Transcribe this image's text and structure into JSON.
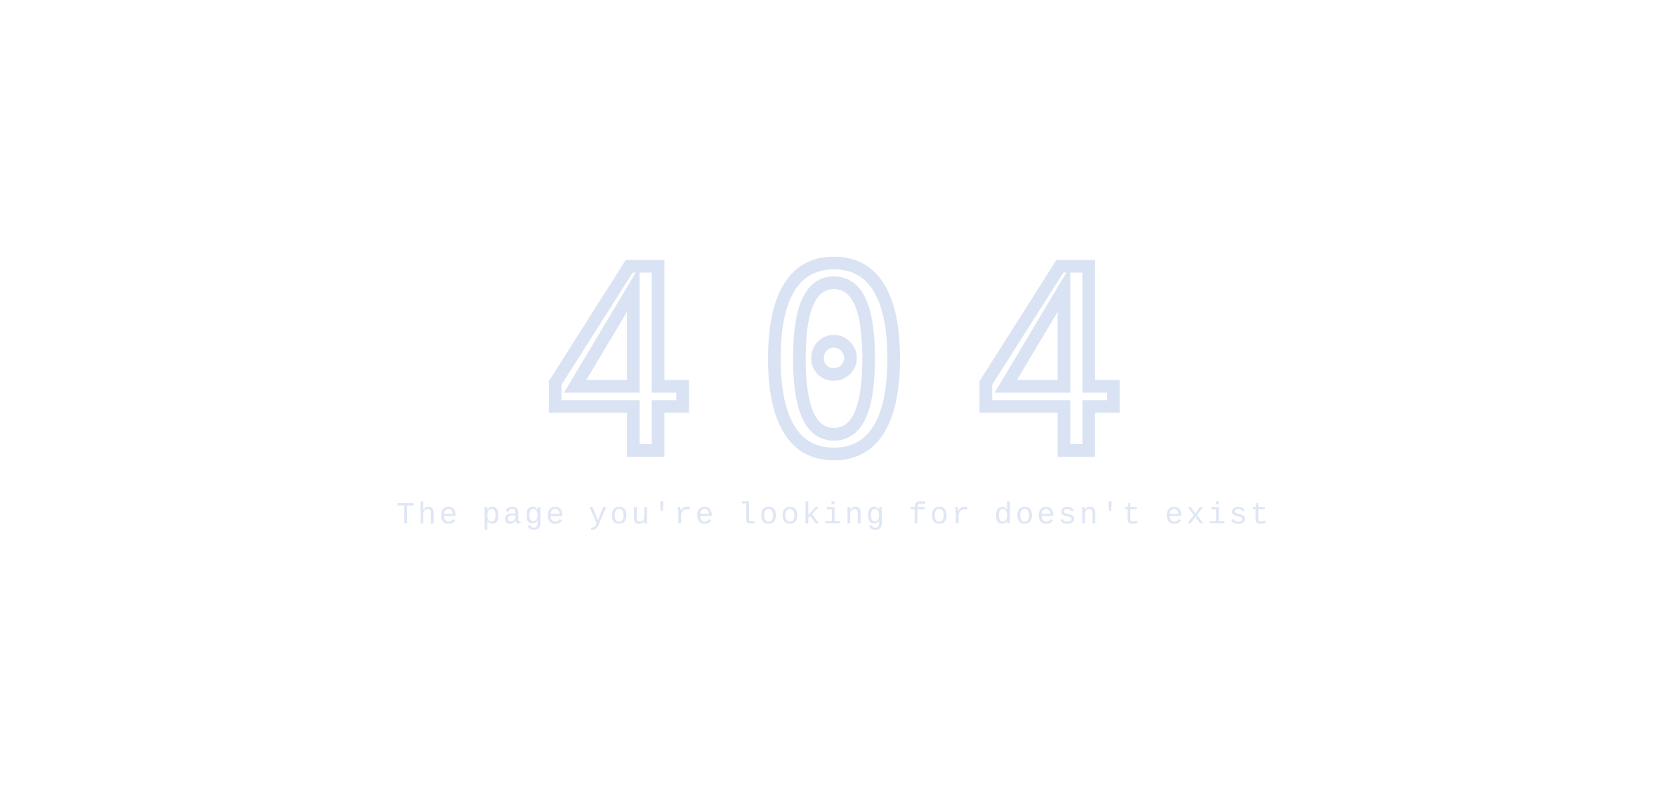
{
  "error": {
    "code": "404",
    "message": "The page you're looking for doesn't exist"
  },
  "colors": {
    "background": "#ffffff",
    "code_outline": "#dae3f3",
    "message_text": "#dfe6f4"
  }
}
